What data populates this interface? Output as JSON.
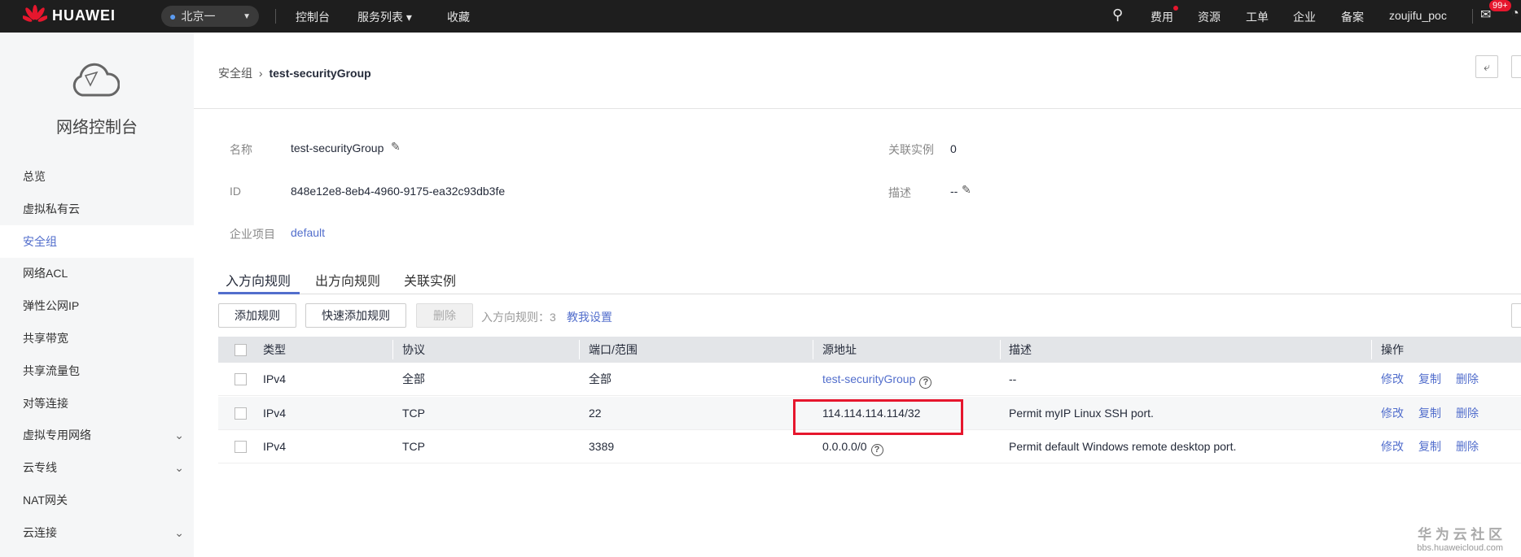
{
  "topbar": {
    "brand": "HUAWEI",
    "region": "北京一",
    "nav": [
      "控制台",
      "服务列表 ▾",
      "收藏"
    ],
    "right": [
      "费用",
      "资源",
      "工单",
      "企业",
      "备案",
      "zoujifu_poc"
    ],
    "badge": "99+"
  },
  "sidebar": {
    "title": "网络控制台",
    "items": [
      {
        "label": "总览"
      },
      {
        "label": "虚拟私有云"
      },
      {
        "label": "安全组",
        "active": true
      },
      {
        "label": "网络ACL"
      },
      {
        "label": "弹性公网IP"
      },
      {
        "label": "共享带宽"
      },
      {
        "label": "共享流量包"
      },
      {
        "label": "对等连接"
      },
      {
        "label": "虚拟专用网络",
        "expandable": true
      },
      {
        "label": "云专线",
        "expandable": true
      },
      {
        "label": "NAT网关"
      },
      {
        "label": "云连接",
        "expandable": true
      }
    ]
  },
  "breadcrumb": {
    "parent": "安全组",
    "current": "test-securityGroup"
  },
  "info": {
    "name_label": "名称",
    "name": "test-securityGroup",
    "id_label": "ID",
    "id": "848e12e8-8eb4-4960-9175-ea32c93db3fe",
    "project_label": "企业项目",
    "project": "default",
    "instances_label": "关联实例",
    "instances": "0",
    "desc_label": "描述",
    "desc": "--"
  },
  "tabs": [
    "入方向规则",
    "出方向规则",
    "关联实例"
  ],
  "toolbar": {
    "add": "添加规则",
    "quick_add": "快速添加规则",
    "delete": "删除",
    "count_label": "入方向规则：",
    "count": "3",
    "help": "教我设置"
  },
  "table": {
    "headers": [
      "类型",
      "协议",
      "端口/范围",
      "源地址",
      "描述",
      "操作"
    ],
    "rows": [
      {
        "type": "IPv4",
        "protocol": "全部",
        "port": "全部",
        "source": "test-securityGroup",
        "source_link": true,
        "desc": "--"
      },
      {
        "type": "IPv4",
        "protocol": "TCP",
        "port": "22",
        "source": "114.114.114.114/32",
        "desc": "Permit myIP Linux SSH port.",
        "highlighted": true
      },
      {
        "type": "IPv4",
        "protocol": "TCP",
        "port": "3389",
        "source": "0.0.0.0/0",
        "desc": "Permit default Windows remote desktop port."
      }
    ],
    "actions": [
      "修改",
      "复制",
      "删除"
    ]
  },
  "watermark": {
    "title": "华 为 云 社 区",
    "url": "bbs.huaweicloud.com"
  },
  "colors": {
    "accent": "#526ecc",
    "highlight": "#e6162d",
    "topbar": "#1e1e1e"
  }
}
